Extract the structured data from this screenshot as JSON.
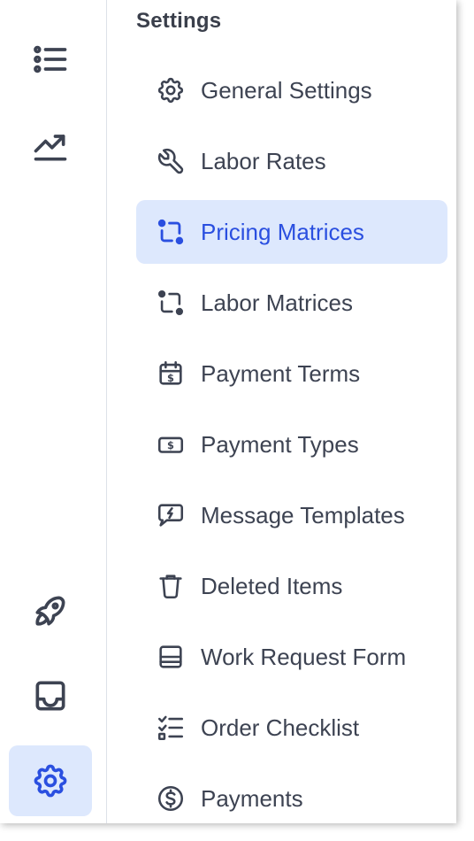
{
  "rail": {
    "items": [
      {
        "icon": "list-icon",
        "active": false
      },
      {
        "icon": "trending-up-icon",
        "active": false
      },
      {
        "icon": "rocket-icon",
        "active": false
      },
      {
        "icon": "inbox-icon",
        "active": false
      },
      {
        "icon": "gear-icon",
        "active": true
      }
    ]
  },
  "settings": {
    "title": "Settings",
    "items": [
      {
        "label": "General Settings",
        "icon": "gear-icon"
      },
      {
        "label": "Labor Rates",
        "icon": "wrench-icon"
      },
      {
        "label": "Pricing Matrices",
        "icon": "matrix-icon",
        "active": true
      },
      {
        "label": "Labor Matrices",
        "icon": "matrix-icon"
      },
      {
        "label": "Payment Terms",
        "icon": "calendar-dollar-icon"
      },
      {
        "label": "Payment Types",
        "icon": "cash-icon"
      },
      {
        "label": "Message Templates",
        "icon": "message-bolt-icon"
      },
      {
        "label": "Deleted Items",
        "icon": "trash-icon"
      },
      {
        "label": "Work Request Form",
        "icon": "form-icon"
      },
      {
        "label": "Order Checklist",
        "icon": "checklist-icon"
      },
      {
        "label": "Payments",
        "icon": "dollar-circle-icon"
      }
    ]
  },
  "colors": {
    "accent": "#2a4fe0",
    "active_bg": "#dde8fd",
    "text": "#3d4352"
  }
}
